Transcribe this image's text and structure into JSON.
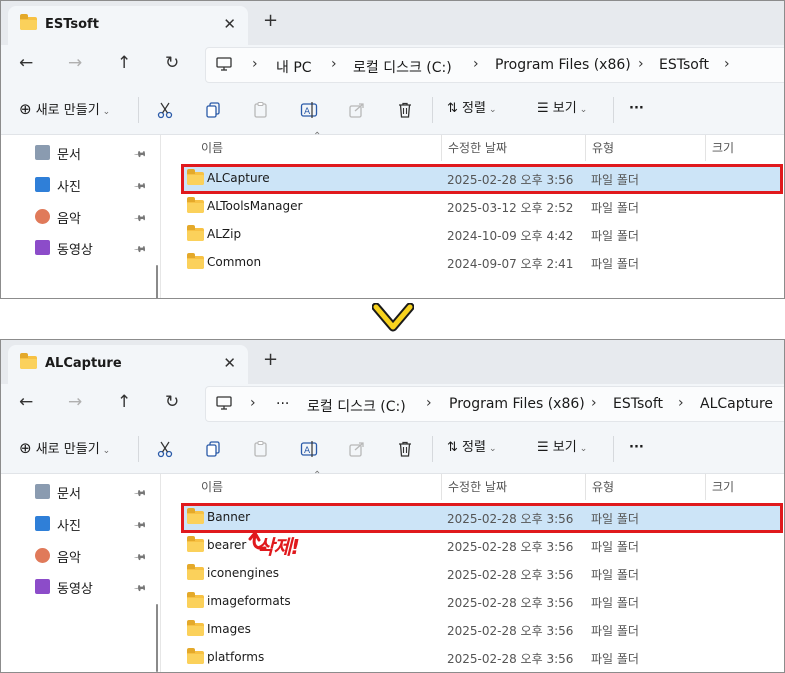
{
  "top_window": {
    "tab": {
      "title": "ESTsoft",
      "close": "✕"
    },
    "new_tab": "+",
    "breadcrumbs": [
      "내 PC",
      "로컬 디스크 (C:)",
      "Program Files (x86)",
      "ESTsoft"
    ],
    "toolbar": {
      "new_label": "새로 만들기",
      "sort_label": "정렬",
      "view_label": "보기",
      "more": "···"
    },
    "sidebar": [
      {
        "label": "문서",
        "icon": "document-icon"
      },
      {
        "label": "사진",
        "icon": "pictures-icon"
      },
      {
        "label": "음악",
        "icon": "music-icon"
      },
      {
        "label": "동영상",
        "icon": "video-icon"
      }
    ],
    "columns": {
      "name": "이름",
      "date": "수정한 날짜",
      "type": "유형",
      "size": "크기"
    },
    "rows": [
      {
        "name": "ALCapture",
        "date": "2025-02-28 오후 3:56",
        "type": "파일 폴더",
        "selected": true
      },
      {
        "name": "ALToolsManager",
        "date": "2025-03-12 오후 2:52",
        "type": "파일 폴더",
        "selected": false
      },
      {
        "name": "ALZip",
        "date": "2024-10-09 오후 4:42",
        "type": "파일 폴더",
        "selected": false
      },
      {
        "name": "Common",
        "date": "2024-09-07 오후 2:41",
        "type": "파일 폴더",
        "selected": false
      }
    ]
  },
  "bottom_window": {
    "tab": {
      "title": "ALCapture",
      "close": "✕"
    },
    "new_tab": "+",
    "breadcrumbs": [
      "···",
      "로컬 디스크 (C:)",
      "Program Files (x86)",
      "ESTsoft",
      "ALCapture"
    ],
    "toolbar": {
      "new_label": "새로 만들기",
      "sort_label": "정렬",
      "view_label": "보기",
      "more": "···"
    },
    "sidebar": [
      {
        "label": "문서",
        "icon": "document-icon"
      },
      {
        "label": "사진",
        "icon": "pictures-icon"
      },
      {
        "label": "음악",
        "icon": "music-icon"
      },
      {
        "label": "동영상",
        "icon": "video-icon"
      }
    ],
    "columns": {
      "name": "이름",
      "date": "수정한 날짜",
      "type": "유형",
      "size": "크기"
    },
    "rows": [
      {
        "name": "Banner",
        "date": "2025-02-28 오후 3:56",
        "type": "파일 폴더",
        "selected": true
      },
      {
        "name": "bearer",
        "date": "2025-02-28 오후 3:56",
        "type": "파일 폴더",
        "selected": false
      },
      {
        "name": "iconengines",
        "date": "2025-02-28 오후 3:56",
        "type": "파일 폴더",
        "selected": false
      },
      {
        "name": "imageformats",
        "date": "2025-02-28 오후 3:56",
        "type": "파일 폴더",
        "selected": false
      },
      {
        "name": "Images",
        "date": "2025-02-28 오후 3:56",
        "type": "파일 폴더",
        "selected": false
      },
      {
        "name": "platforms",
        "date": "2025-02-28 오후 3:56",
        "type": "파일 폴더",
        "selected": false
      }
    ]
  },
  "annotation": {
    "text": "삭제!",
    "color": "#e0191d"
  },
  "colors": {
    "selection": "#cce4f7",
    "highlight_border": "#e0191d",
    "folder": "#f7c143",
    "arrow": "#f7d21e"
  }
}
